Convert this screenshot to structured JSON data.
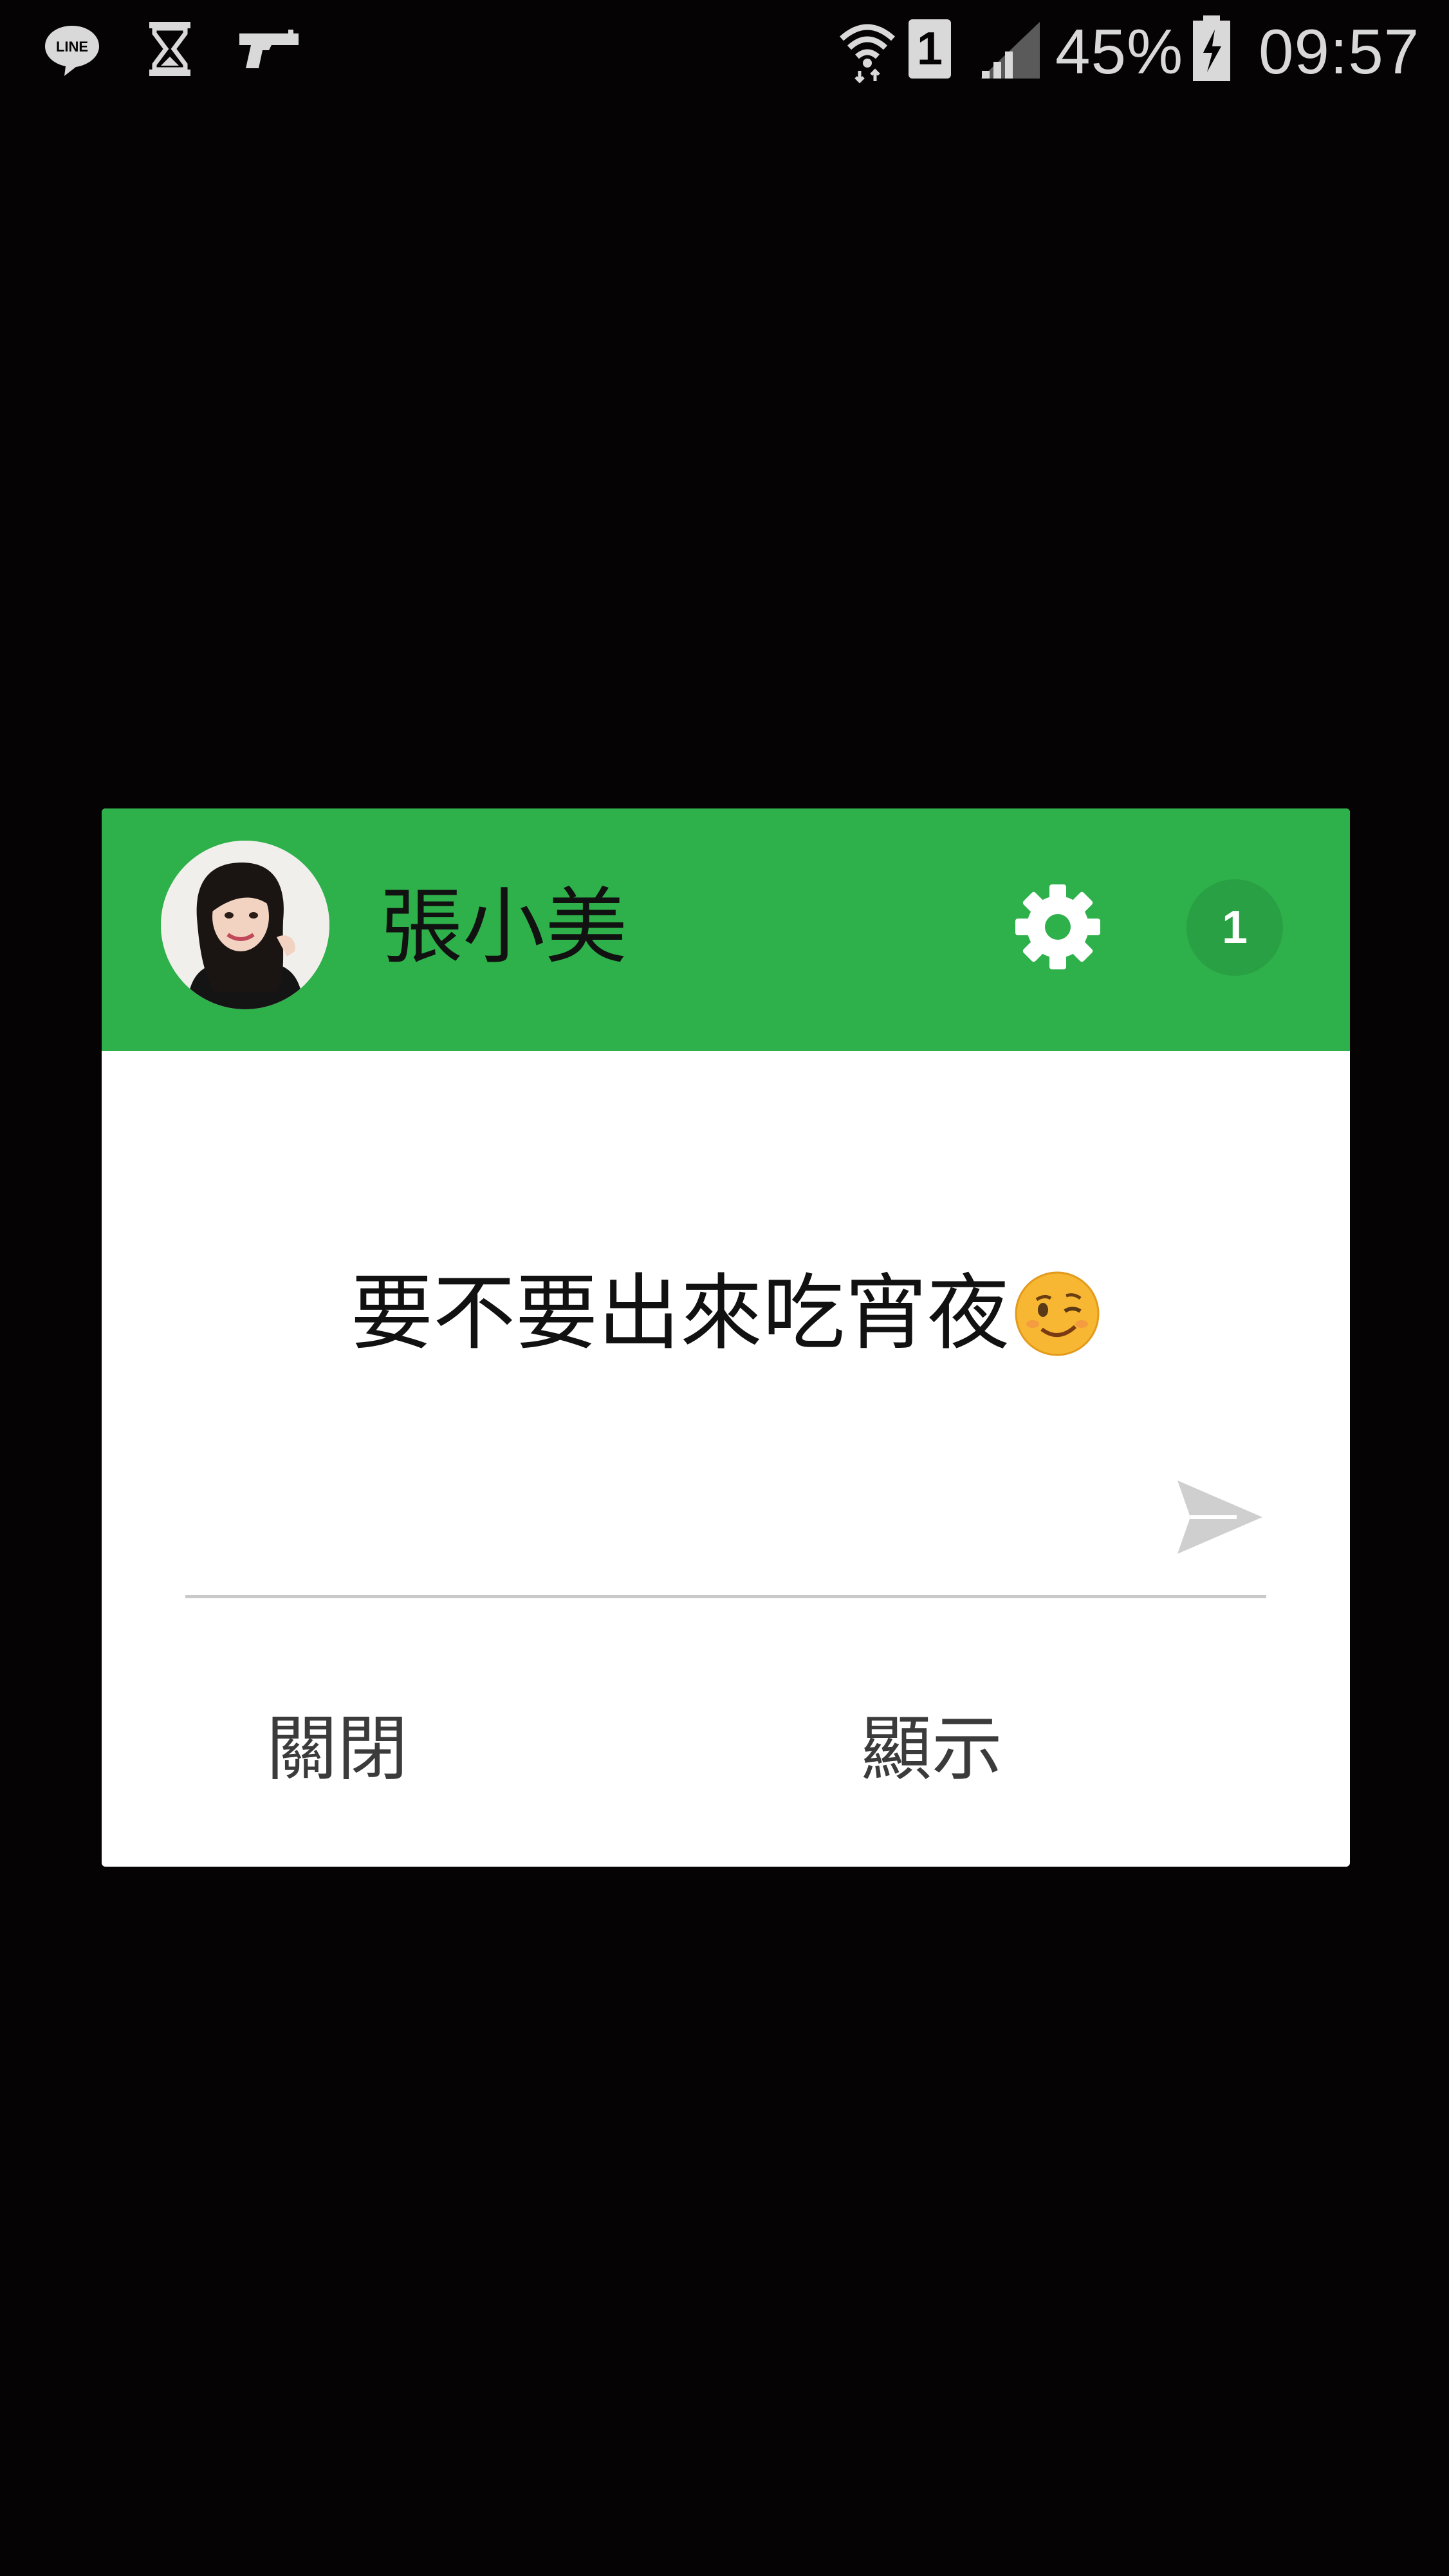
{
  "status_bar": {
    "left_icons": [
      "line-app-icon",
      "hourglass-icon",
      "pistol-icon"
    ],
    "right_icons": [
      "wifi-icon",
      "sim-1-icon",
      "cellular-signal-icon",
      "battery-charging-icon"
    ],
    "sim_label": "1",
    "battery_percent": "45%",
    "time": "09:57"
  },
  "popup": {
    "header_color": "#2eb04a",
    "sender_name": "張小美",
    "settings_icon": "gear-icon",
    "unread_count": "1",
    "message": "要不要出來吃宵夜",
    "message_emoji": "winking-face-emoji",
    "reply_placeholder": "",
    "send_icon": "send-arrow-icon",
    "close_label": "關閉",
    "show_label": "顯示"
  }
}
